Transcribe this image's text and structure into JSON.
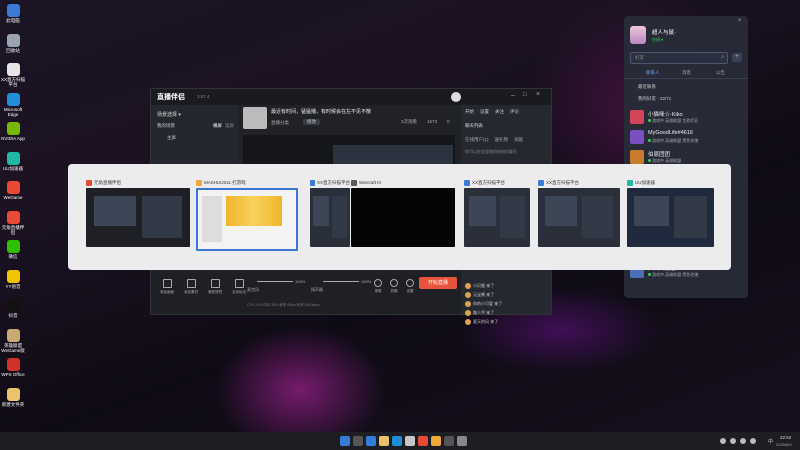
{
  "desktop": {
    "icons": [
      {
        "label": "此电脑",
        "color": "#3a7bd5"
      },
      {
        "label": "回收站",
        "color": "#9aa4b0"
      },
      {
        "label": "XX直方扫描平台",
        "color": "#e6e6e6"
      },
      {
        "label": "Microsoft Edge",
        "color": "#1e8fd8"
      },
      {
        "label": "NVIDIA App",
        "color": "#76b900"
      },
      {
        "label": "UU加速器",
        "color": "#22b8a6"
      },
      {
        "label": "WeGame",
        "color": "#e84a34"
      },
      {
        "label": "元角直播伴侣",
        "color": "#e84a34"
      },
      {
        "label": "微信",
        "color": "#2dc100"
      },
      {
        "label": "YY语音",
        "color": "#f3c400"
      },
      {
        "label": "抖音",
        "color": "#111111"
      },
      {
        "label": "英雄联盟WeGame版",
        "color": "#c8aa6e"
      },
      {
        "label": "WPS Office",
        "color": "#d0312d"
      },
      {
        "label": "新建文件夹",
        "color": "#e9c46a"
      }
    ]
  },
  "live_app": {
    "logo": "直播伴侣",
    "version": "3.57.4",
    "scene_label": "场景选择 ▾",
    "scene_tabs": [
      "我的场景",
      "横屏",
      "竖屏"
    ],
    "scene_item": "主屏",
    "stream_title": "最近有时间，猛猛播，有时候会在左不见不散",
    "stream_sub": "直播分类",
    "tag_button": "修改",
    "stats": [
      "3次观看",
      "1573",
      "0"
    ],
    "right_tabs": [
      "开始",
      "设置",
      "关注",
      "评论"
    ],
    "comment_panel_title": "聊天列表",
    "comment_panel_tabs": [
      "在线用户(1)",
      "送礼物",
      "贡献"
    ],
    "comment_placeholder": "你可以在这里和你的粉丝聊天",
    "go_live_button": "开始直播",
    "bottom_tools": [
      "添加画面",
      "添加素材",
      "美颜滤镜",
      "互动玩法"
    ],
    "volume1_label": "麦克风",
    "volume1_value": "100%",
    "volume2_label": "扬声器",
    "volume2_value": "100%",
    "bottom_icons": [
      "录像",
      "剪辑",
      "设置"
    ],
    "chat_lines": [
      "小贝猫 来了",
      "元宝酱 来了",
      "你的小可爱 来了",
      "路人甲 来了",
      "夏天的风 来了"
    ],
    "status_bar": "CPU 24%   内存 38%   帧率 60fps   码率 6000kbps"
  },
  "alt_tab": {
    "windows": [
      {
        "title": "元角直播伴侣",
        "icon_color": "#e84a34"
      },
      {
        "title": "MASHUU511·打游戏",
        "icon_color": "#f2a93b"
      },
      {
        "title": "XX直方扫描平台",
        "icon_color": "#3a7bd5"
      },
      {
        "title": "Warcraft III",
        "icon_color": "#5a5a5a"
      },
      {
        "title": "XX直方扫描平台",
        "icon_color": "#3a7bd5"
      },
      {
        "title": "XX直方扫描平台",
        "icon_color": "#3a7bd5"
      },
      {
        "title": "UU加速器",
        "icon_color": "#22b8a6"
      }
    ]
  },
  "friends": {
    "username": "超人与鼠·",
    "status": "在线 ▾",
    "search_placeholder": "好友",
    "tabs": [
      "联系人",
      "消息",
      "公告"
    ],
    "group_recent": "最近联系",
    "group_my": "我的好友 · 22/71",
    "list": [
      {
        "name": "小猫咪☆·Kiko",
        "sub": "游戏中 英雄联盟 艾欧尼亚",
        "color": "#d1465a"
      },
      {
        "name": "MyGoodLife#4616",
        "sub": "游戏中 英雄联盟 黑色玫瑰",
        "color": "#7a4fbf"
      },
      {
        "name": "伯恩团团",
        "sub": "游戏中 英雄联盟",
        "color": "#c87d2e"
      },
      {
        "name": "阿狸狸·",
        "sub": "游戏中 英雄联盟",
        "color": "#b8418a"
      },
      {
        "name": "广西大骚逼#5775",
        "sub": "游戏中 英雄联盟 黑色玫瑰",
        "color": "#4a6fb4"
      }
    ]
  },
  "taskbar": {
    "time": "22:52",
    "date": "2025/6/9",
    "lang": "中"
  }
}
